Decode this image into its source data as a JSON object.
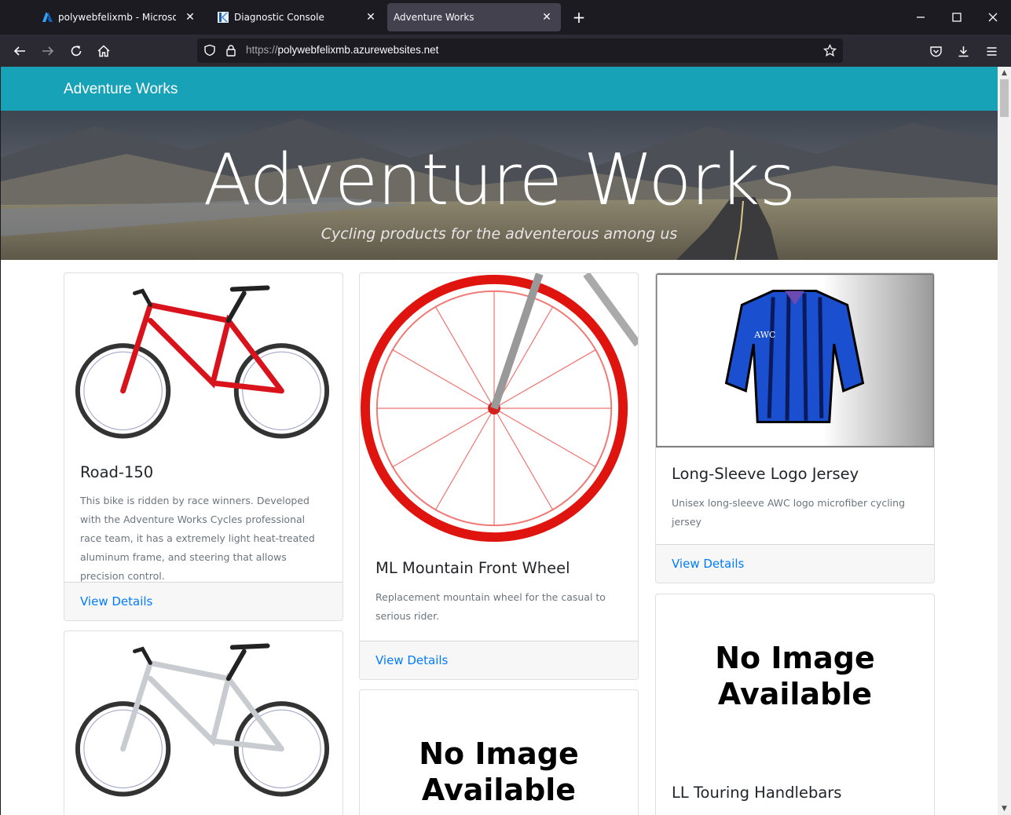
{
  "browser": {
    "tabs": [
      {
        "title": "polywebfelixmb - Microsoft Azure",
        "active": false
      },
      {
        "title": "Diagnostic Console",
        "active": false
      },
      {
        "title": "Adventure Works",
        "active": true
      }
    ],
    "url_protocol": "https://",
    "url_host": "polywebfelixmb.azurewebsites.net"
  },
  "site": {
    "brand": "Adventure Works",
    "hero_title": "Adventure Works",
    "hero_subtitle": "Cycling products for the adventerous among us"
  },
  "products": [
    {
      "title": "Road-150",
      "description": "This bike is ridden by race winners. Developed with the Adventure Works Cycles professional race team, it has a extremely light heat-treated aluminum frame, and steering that allows precision control.",
      "link": "View Details",
      "image": "red-bike"
    },
    {
      "title": "ML Mountain Front Wheel",
      "description": "Replacement mountain wheel for the casual to serious rider.",
      "link": "View Details",
      "image": "red-wheel"
    },
    {
      "title": "Long-Sleeve Logo Jersey",
      "description": "Unisex long-sleeve AWC logo microfiber cycling jersey",
      "link": "View Details",
      "image": "jersey",
      "image_text": "AWC"
    },
    {
      "title": "",
      "description": "",
      "link": "",
      "image": "silver-bike"
    },
    {
      "title": "",
      "description": "",
      "link": "",
      "image": "no-image",
      "image_text": [
        "No Image",
        "Available"
      ]
    },
    {
      "title": "LL Touring Handlebars",
      "description": "",
      "link": "",
      "image": "no-image",
      "image_text": [
        "No Image",
        "Available"
      ]
    }
  ],
  "colors": {
    "navbar": "#17a2b8",
    "link": "#007bff",
    "chrome_dark": "#1c1b22",
    "chrome_toolbar": "#2b2a33",
    "active_tab": "#42414d"
  }
}
